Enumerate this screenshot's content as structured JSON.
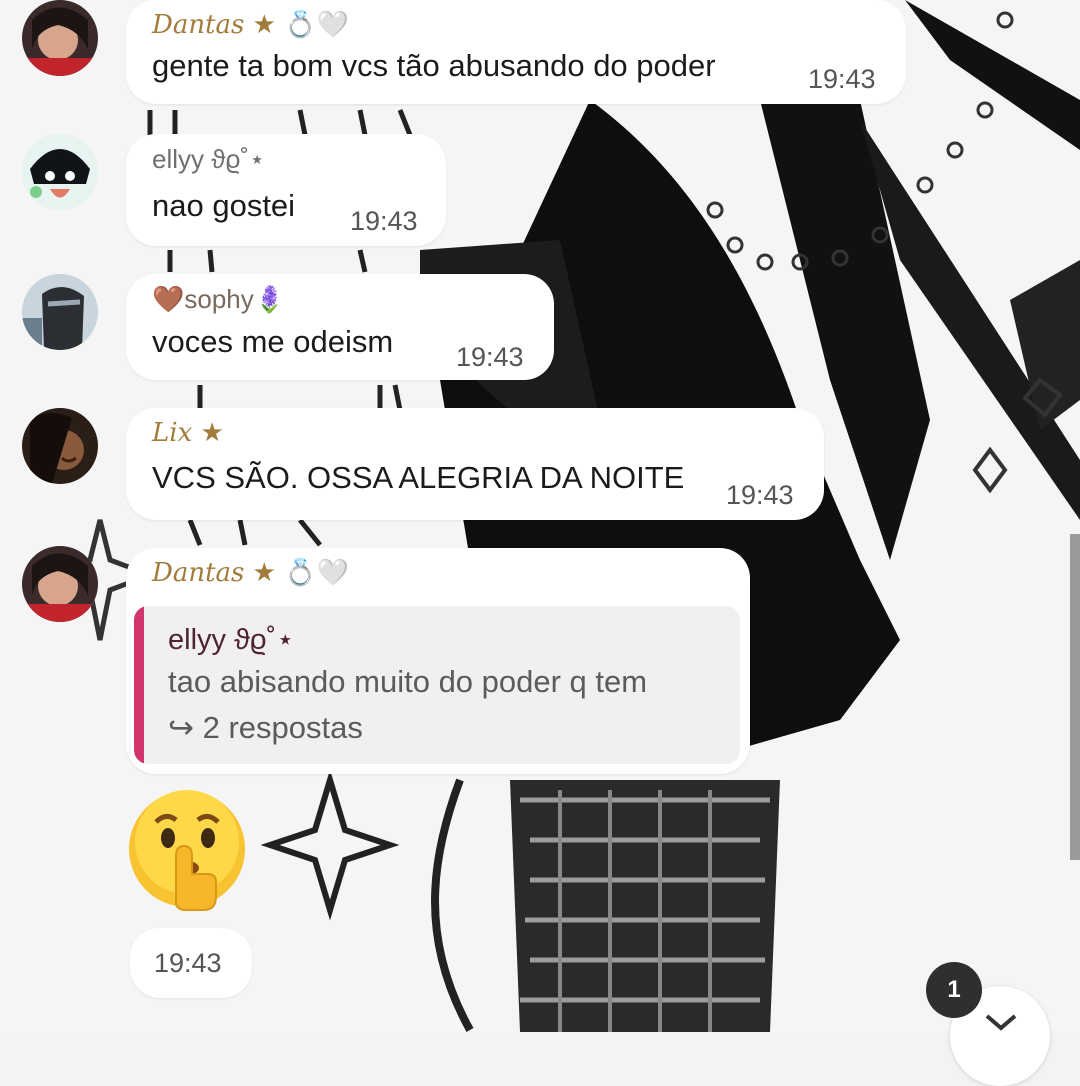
{
  "messages": [
    {
      "author": "Dantas",
      "badges": "★ 💍🤍",
      "text": "gente ta bom vcs tão abusando do poder",
      "time": "19:43"
    },
    {
      "author": "ellyy",
      "badges": "ϑϱ˚⋆",
      "text": "nao gostei",
      "time": "19:43"
    },
    {
      "author": "sophy",
      "prefix": "🤎",
      "badges": "🪻",
      "text": "voces me odeism",
      "time": "19:43"
    },
    {
      "author": "Lix",
      "badges": "★",
      "text": "VCS SÃO. OSSA ALEGRIA DA NOITE",
      "time": "19:43"
    },
    {
      "author": "Dantas",
      "badges": "★ 💍🤍",
      "reply": {
        "author": "ellyy ϑϱ˚⋆",
        "text": "tao abisando muito do poder q tem",
        "replies": "↪ 2 respostas"
      }
    }
  ],
  "emoji_message": {
    "emoji": "shushing-face",
    "time": "19:43"
  },
  "unread_badge": "1",
  "colors": {
    "name_gold": "#a17c3b",
    "quote_bar": "#d2356d",
    "bubble": "#ffffff"
  }
}
